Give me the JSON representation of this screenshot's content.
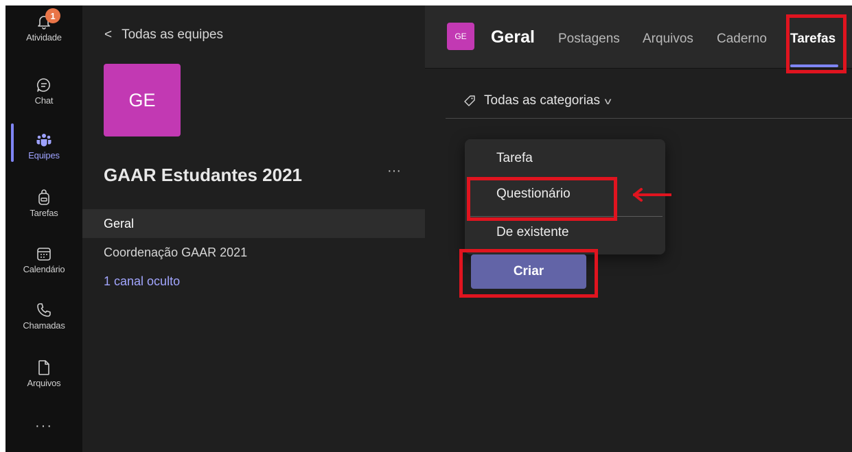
{
  "rail": {
    "activity_label": "Atividade",
    "activity_badge": "1",
    "chat_label": "Chat",
    "teams_label": "Equipes",
    "assignments_label": "Tarefas",
    "calendar_label": "Calendário",
    "calls_label": "Chamadas",
    "files_label": "Arquivos",
    "more_label": "···"
  },
  "pane": {
    "back_label": "Todas as equipes",
    "team_initials": "GE",
    "team_name": "GAAR Estudantes 2021",
    "team_more": "···",
    "channels": [
      {
        "label": "Geral"
      },
      {
        "label": "Coordenação GAAR 2021"
      }
    ],
    "hidden_channels": "1 canal oculto"
  },
  "main": {
    "avatar_initials": "GE",
    "channel_title": "Geral",
    "tabs": [
      {
        "label": "Postagens"
      },
      {
        "label": "Arquivos"
      },
      {
        "label": "Caderno"
      },
      {
        "label": "Tarefas"
      }
    ],
    "filter_label": "Todas as categorias",
    "menu_items": [
      {
        "label": "Tarefa"
      },
      {
        "label": "Questionário"
      },
      {
        "label": "De existente"
      }
    ],
    "create_label": "Criar"
  },
  "colors": {
    "accent": "#7f85f5",
    "button": "#6264a7",
    "team_avatar": "#c239b3",
    "badge": "#e97548",
    "highlight": "#e0141f"
  }
}
